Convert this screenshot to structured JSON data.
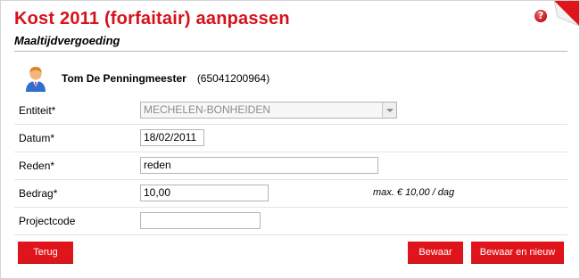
{
  "header": {
    "title": "Kost 2011 (forfaitair) aanpassen",
    "subtitle": "Maaltijdvergoeding",
    "help_icon": "help-icon",
    "help_glyph": "?"
  },
  "user": {
    "name": "Tom De Penningmeester",
    "id": "(65041200964)",
    "icon": "user-avatar-icon"
  },
  "form": {
    "entity": {
      "label": "Entiteit*",
      "value": "MECHELEN-BONHEIDEN"
    },
    "date": {
      "label": "Datum*",
      "value": "18/02/2011"
    },
    "reason": {
      "label": "Reden*",
      "value": "reden"
    },
    "amount": {
      "label": "Bedrag*",
      "value": "10,00",
      "hint": "max. € 10,00 / dag"
    },
    "project": {
      "label": "Projectcode",
      "value": ""
    }
  },
  "actions": {
    "back": "Terug",
    "save": "Bewaar",
    "save_new": "Bewaar en nieuw"
  },
  "colors": {
    "accent": "#d8101a",
    "button": "#e0141b"
  }
}
